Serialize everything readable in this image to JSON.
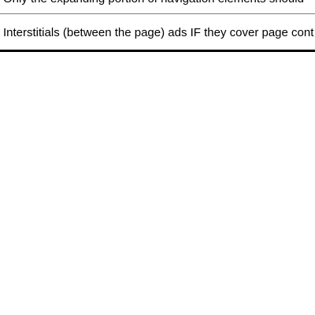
{
  "table": {
    "rows": [
      {
        "text": "Only the expanding portion of navigation elements should"
      },
      {
        "text": "Interstitials (between the page) ads IF they cover page cont"
      }
    ]
  }
}
